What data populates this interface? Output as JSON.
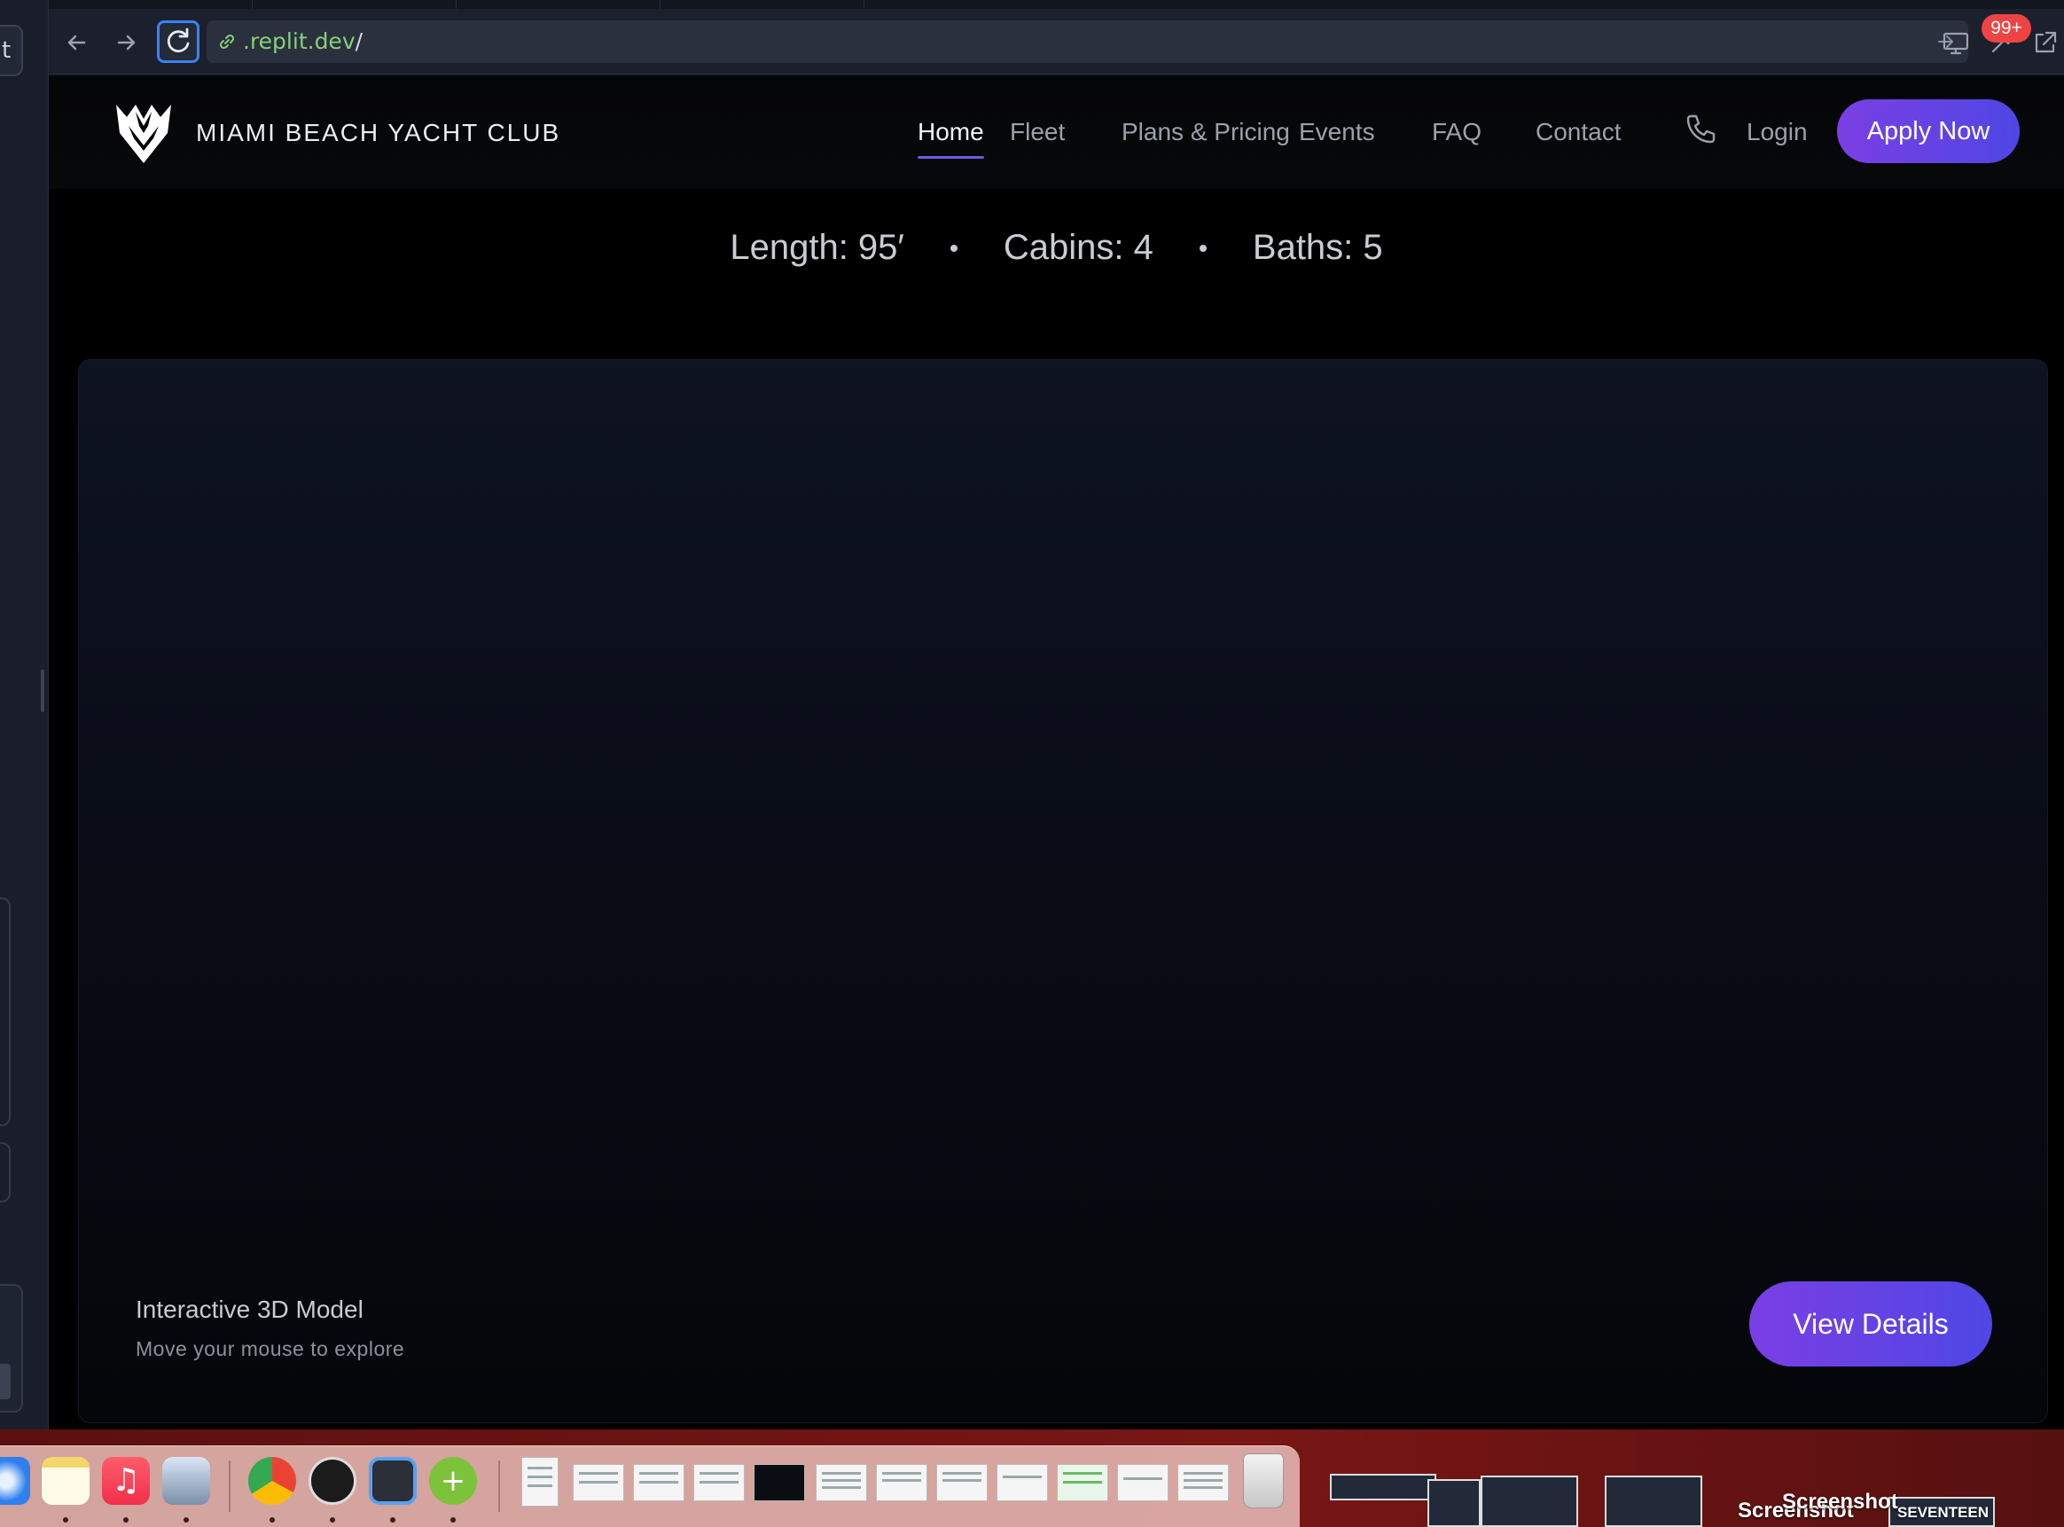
{
  "left_panel": {
    "label": "t"
  },
  "browser": {
    "url_host": ".replit.dev",
    "url_path": "/",
    "notification_count": "99+"
  },
  "site": {
    "brand_name": "MIAMI BEACH YACHT CLUB",
    "nav": [
      {
        "label": "Home",
        "active": true
      },
      {
        "label": "Fleet"
      },
      {
        "label": "Plans & Pricing"
      },
      {
        "label": "Events"
      },
      {
        "label": "FAQ"
      },
      {
        "label": "Contact"
      }
    ],
    "login_label": "Login",
    "apply_label": "Apply Now",
    "specs": {
      "length": "Length: 95′",
      "cabins": "Cabins: 4",
      "baths": "Baths: 5"
    },
    "viewer": {
      "title": "Interactive 3D Model",
      "subtitle": "Move your mouse to explore",
      "details_label": "View Details"
    },
    "accent_gradient": [
      "#7b3fe4",
      "#4f46e5"
    ]
  },
  "desktop": {
    "label_1": "Screenshot",
    "label_2": "Screenshot",
    "label_3": "SEVENTEEN"
  }
}
